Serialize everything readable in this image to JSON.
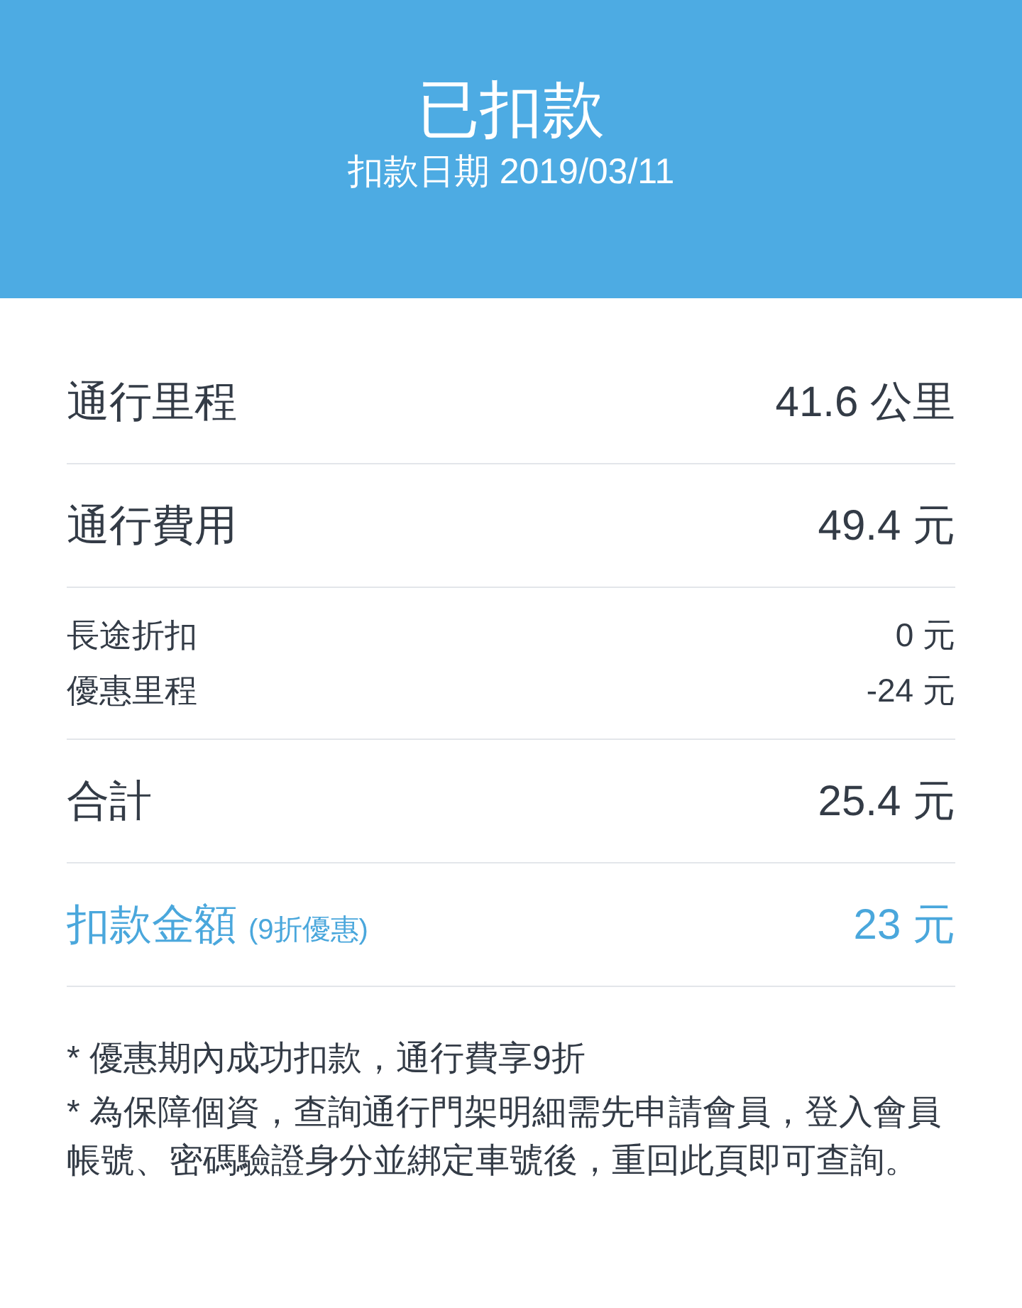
{
  "header": {
    "title": "已扣款",
    "subtitle": "扣款日期 2019/03/11"
  },
  "rows": [
    {
      "kind": "main",
      "label": "通行里程",
      "value": "41.6 公里"
    },
    {
      "kind": "main",
      "label": "通行費用",
      "value": "49.4 元"
    },
    {
      "kind": "detail",
      "items": [
        {
          "label": "長途折扣",
          "value": "0 元"
        },
        {
          "label": "優惠里程",
          "value": "-24 元"
        }
      ]
    },
    {
      "kind": "main",
      "label": "合計",
      "value": "25.4 元"
    },
    {
      "kind": "highlight",
      "label": "扣款金額",
      "note": "(9折優惠)",
      "value": "23 元"
    }
  ],
  "notes": [
    "* 優惠期內成功扣款，通行費享9折",
    "* 為保障個資，查詢通行門架明細需先申請會員，登入會員帳號、密碼驗證身分並綁定車號後，重回此頁即可查詢。"
  ]
}
